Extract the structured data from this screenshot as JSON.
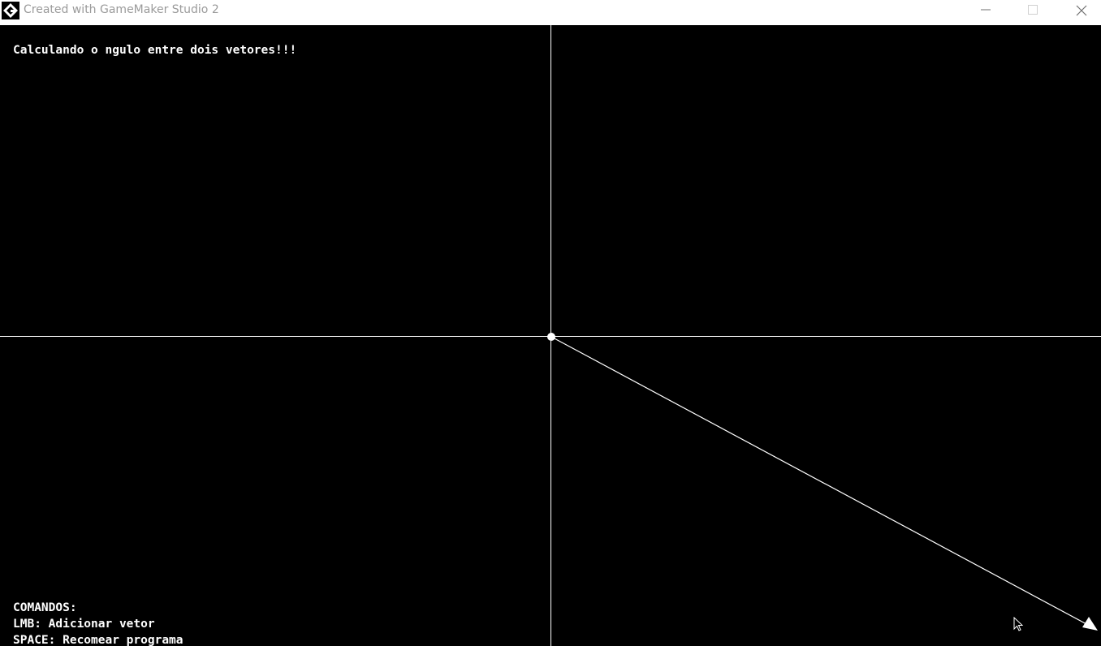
{
  "window": {
    "title": "Created with GameMaker Studio 2",
    "app_icon": "gamemaker-logo-icon",
    "controls": [
      "minimize-icon",
      "maximize-icon",
      "close-icon"
    ]
  },
  "game": {
    "heading": "Calculando o ngulo entre dois vetores!!!",
    "commands": {
      "title": "COMANDOS:",
      "lmb": "LMB: Adicionar vetor",
      "space": "SPACE: Recomear programa"
    },
    "colors": {
      "background": "#000000",
      "foreground": "#ffffff"
    },
    "icons": {
      "origin": "origin-dot-icon",
      "arrowhead": "arrowhead-icon",
      "cursor": "mouse-cursor-icon"
    }
  }
}
